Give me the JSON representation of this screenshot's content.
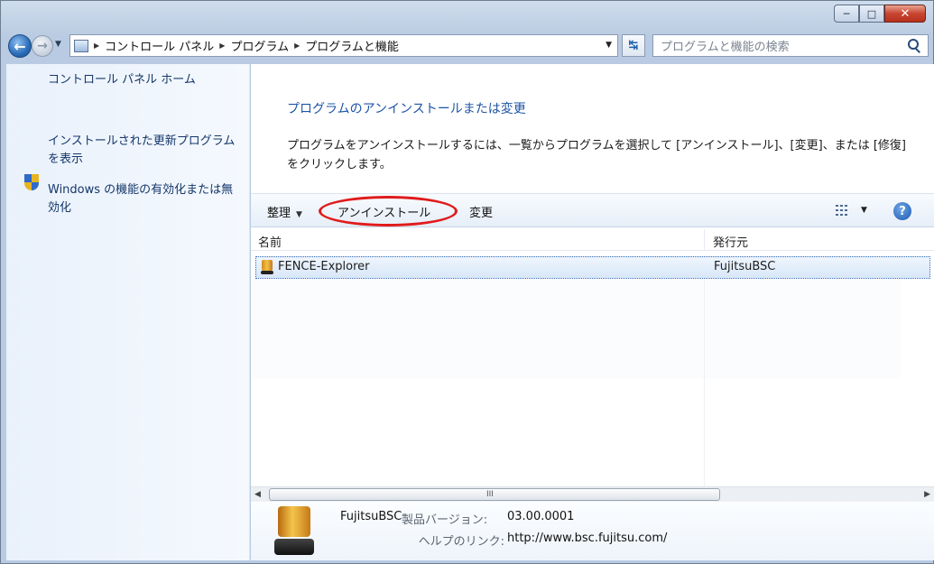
{
  "titlebar": {
    "minimize_glyph": "─",
    "maximize_glyph": "□",
    "close_glyph": "✕"
  },
  "address": {
    "crumbs": [
      "コントロール パネル",
      "プログラム",
      "プログラムと機能"
    ],
    "search_placeholder": "プログラムと機能の検索"
  },
  "sidebar": {
    "home": "コントロール パネル ホーム",
    "updates": "インストールされた更新プログラムを表示",
    "features": "Windows の機能の有効化または無効化"
  },
  "main": {
    "heading": "プログラムのアンインストールまたは変更",
    "instruction": "プログラムをアンインストールするには、一覧からプログラムを選択して [アンインストール]、[変更]、または [修復] をクリックします。"
  },
  "toolbar": {
    "organize": "整理",
    "uninstall": "アンインストール",
    "change": "変更"
  },
  "list": {
    "columns": [
      "名前",
      "発行元"
    ],
    "rows": [
      {
        "name": "FENCE-Explorer",
        "publisher": "FujitsuBSC"
      }
    ],
    "scroll_grip": "III"
  },
  "details": {
    "publisher": "FujitsuBSC",
    "version_label": "製品バージョン:",
    "version_value": "03.00.0001",
    "help_label": "ヘルプのリンク:",
    "help_value": "http://www.bsc.fujitsu.com/"
  },
  "colors": {
    "link": "#1d54a5",
    "highlight_circle": "#e01b1b",
    "selection": "#d8e7f8"
  }
}
